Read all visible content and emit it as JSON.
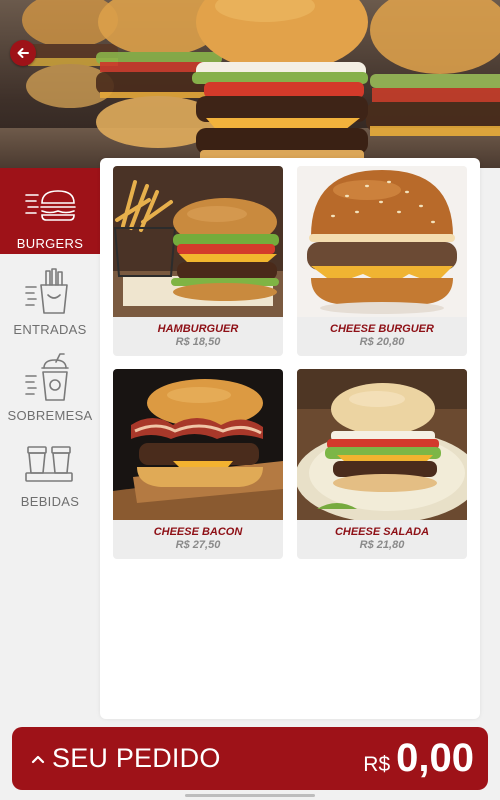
{
  "header": {
    "back_icon": "arrow-left-icon"
  },
  "colors": {
    "brand_red": "#9e1218",
    "product_name_red": "#8e1016",
    "inactive_text": "#6f6f6f",
    "price_gray": "#8a8a8a"
  },
  "sidebar": {
    "items": [
      {
        "label": "BURGERS",
        "icon": "burger-icon",
        "active": true
      },
      {
        "label": "ENTRADAS",
        "icon": "fries-icon",
        "active": false
      },
      {
        "label": "SOBREMESA",
        "icon": "milkshake-icon",
        "active": false
      },
      {
        "label": "BEBIDAS",
        "icon": "drinks-icon",
        "active": false
      }
    ]
  },
  "products": [
    {
      "name": "HAMBURGUER",
      "price": "R$ 18,50"
    },
    {
      "name": "CHEESE BURGUER",
      "price": "R$ 20,80"
    },
    {
      "name": "CHEESE BACON",
      "price": "R$ 27,50"
    },
    {
      "name": "CHEESE SALADA",
      "price": "R$ 21,80"
    }
  ],
  "order": {
    "title": "SEU PEDIDO",
    "currency": "R$",
    "total": "0,00",
    "toggle_icon": "chevron-up-icon"
  }
}
